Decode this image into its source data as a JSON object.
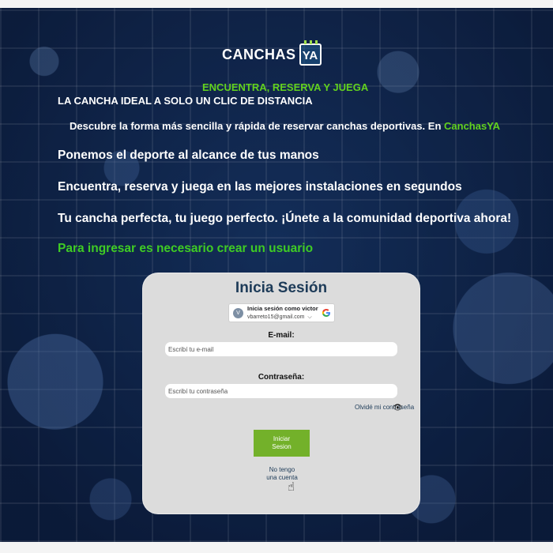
{
  "brand": {
    "logo_word": "CANCHAS",
    "logo_badge": "YA",
    "accent_green": "#62d21e",
    "title_blue": "#1d3b58"
  },
  "hero": {
    "tagline": "ENCUENTRA, RESERVA Y JUEGA",
    "subtag": "LA CANCHA IDEAL A SOLO UN CLIC DE DISTANCIA",
    "discover_text": "Descubre la forma más sencilla y rápida de reservar canchas deportivas. En ",
    "discover_brand": "CanchasYA",
    "line1": "Ponemos el deporte al alcance de tus manos",
    "line2": "Encuentra, reserva y juega en las mejores instalaciones en segundos",
    "line3": "Tu cancha perfecta, tu juego perfecto. ¡Únete a la comunidad deportiva ahora!",
    "line4": "Para ingresar es necesario crear un usuario"
  },
  "login": {
    "title": "Inicia Sesión",
    "google": {
      "avatar_letter": "V",
      "line1": "Inicia sesión como victor",
      "email": "vbarreto15@gmail.com"
    },
    "email_label": "E-mail:",
    "email_placeholder": "Escribí tu e-mail",
    "password_label": "Contraseña:",
    "password_placeholder": "Escribí tu contraseña",
    "forgot_link": "Olvidé mi contraseña",
    "submit_line1": "Iniciar",
    "submit_line2": "Sesion",
    "signup_line1": "No tengo",
    "signup_line2": "una cuenta"
  },
  "icons": {
    "eye": "eye-icon",
    "cursor": "hand-pointer-icon",
    "google": "google-g-icon",
    "calendar": "calendar-icon"
  }
}
